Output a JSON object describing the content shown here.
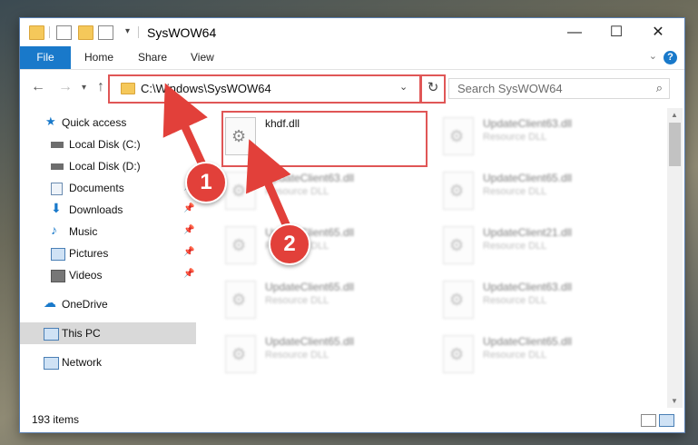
{
  "window": {
    "title": "SysWOW64",
    "controls": {
      "minimize": "—",
      "maximize": "☐",
      "close": "✕"
    }
  },
  "ribbon": {
    "tabs": [
      "File",
      "Home",
      "Share",
      "View"
    ],
    "help": "?"
  },
  "address": {
    "path": "C:\\Windows\\SysWOW64",
    "search_placeholder": "Search SysWOW64"
  },
  "navpane": {
    "items": [
      {
        "label": "Quick access",
        "icon": "star-icon",
        "pinned": false
      },
      {
        "label": "Local Disk (C:)",
        "icon": "drive-icon",
        "pinned": false
      },
      {
        "label": "Local Disk (D:)",
        "icon": "drive-icon",
        "pinned": false
      },
      {
        "label": "Documents",
        "icon": "documents-icon",
        "pinned": true
      },
      {
        "label": "Downloads",
        "icon": "download-icon",
        "pinned": true
      },
      {
        "label": "Music",
        "icon": "music-icon",
        "pinned": true
      },
      {
        "label": "Pictures",
        "icon": "pictures-icon",
        "pinned": true
      },
      {
        "label": "Videos",
        "icon": "videos-icon",
        "pinned": true
      },
      {
        "label": "OneDrive",
        "icon": "cloud-icon",
        "pinned": false
      },
      {
        "label": "This PC",
        "icon": "computer-icon",
        "pinned": false,
        "selected": true
      },
      {
        "label": "Network",
        "icon": "network-icon",
        "pinned": false
      }
    ]
  },
  "files": [
    {
      "name": "khdf.dll",
      "type": "",
      "highlighted": true
    },
    {
      "name": "UpdateClient63.dll",
      "type": "Resource DLL"
    },
    {
      "name": "UpdateClient63.dll",
      "type": "Resource DLL"
    },
    {
      "name": "UpdateClient65.dll",
      "type": "Resource DLL"
    },
    {
      "name": "UpdateClient65.dll",
      "type": "Resource DLL"
    },
    {
      "name": "UpdateClient21.dll",
      "type": "Resource DLL"
    },
    {
      "name": "UpdateClient65.dll",
      "type": "Resource DLL"
    },
    {
      "name": "UpdateClient63.dll",
      "type": "Resource DLL"
    },
    {
      "name": "UpdateClient65.dll",
      "type": "Resource DLL"
    },
    {
      "name": "UpdateClient65.dll",
      "type": "Resource DLL"
    }
  ],
  "status": {
    "items": "193 items"
  },
  "callouts": {
    "one": "1",
    "two": "2"
  },
  "colors": {
    "accent": "#1979ca",
    "highlight": "#e05656",
    "callout": "#e2403a"
  }
}
